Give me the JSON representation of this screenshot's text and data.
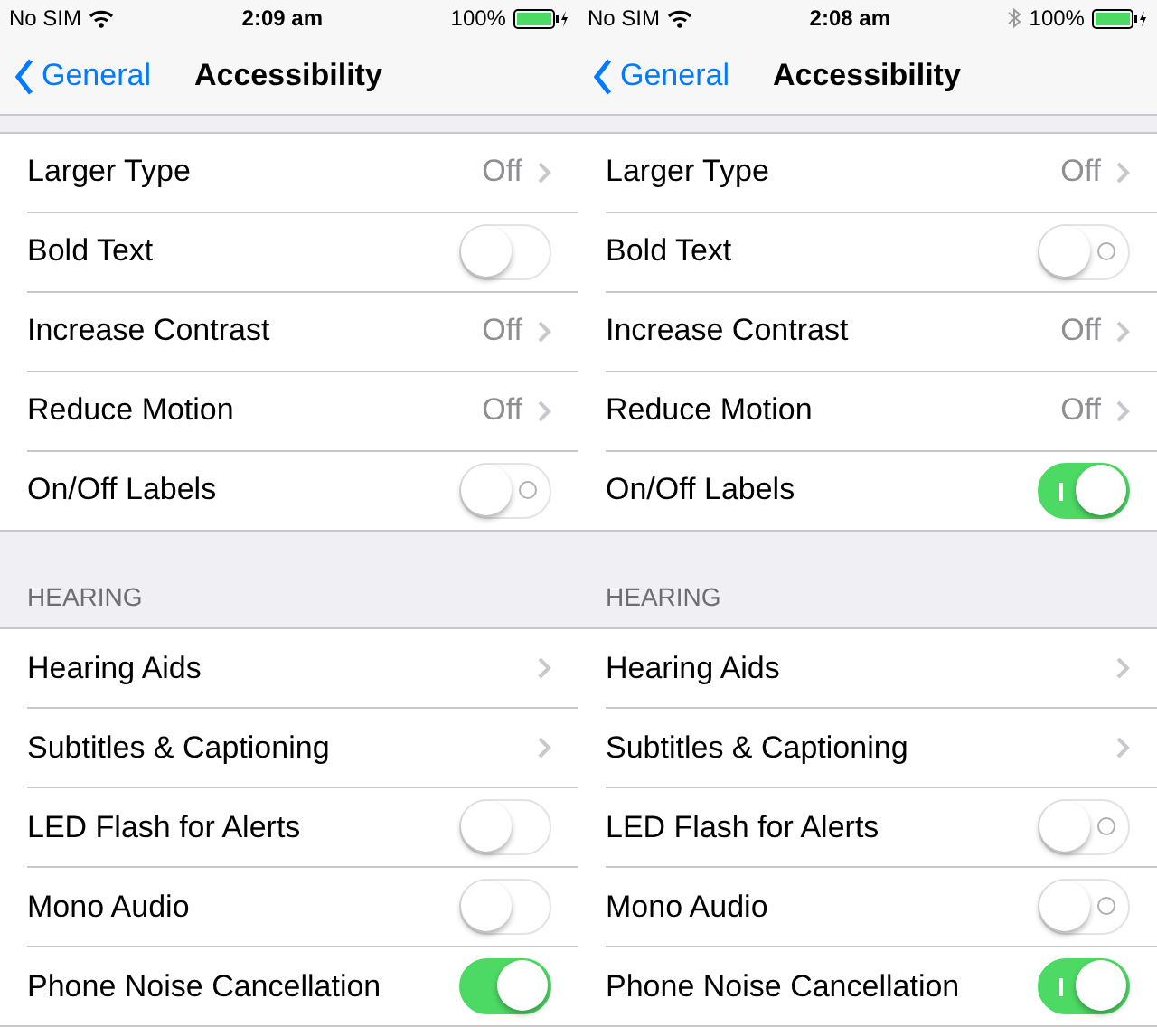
{
  "screens": [
    {
      "status_bar": {
        "carrier": "No SIM",
        "time": "2:09 am",
        "bluetooth": false,
        "battery": "100%"
      },
      "nav": {
        "back": "General",
        "title": "Accessibility"
      },
      "sections": [
        {
          "rows": [
            {
              "kind": "disclosure",
              "label": "Larger Type",
              "value": "Off"
            },
            {
              "kind": "switch",
              "label": "Bold Text",
              "on": false,
              "label_mark": false
            },
            {
              "kind": "disclosure",
              "label": "Increase Contrast",
              "value": "Off"
            },
            {
              "kind": "disclosure",
              "label": "Reduce Motion",
              "value": "Off"
            },
            {
              "kind": "switch",
              "label": "On/Off Labels",
              "on": false,
              "label_mark": true
            }
          ]
        },
        {
          "header": "HEARING",
          "rows": [
            {
              "kind": "disclosure",
              "label": "Hearing Aids"
            },
            {
              "kind": "disclosure",
              "label": "Subtitles & Captioning"
            },
            {
              "kind": "switch",
              "label": "LED Flash for Alerts",
              "on": false,
              "label_mark": false
            },
            {
              "kind": "switch",
              "label": "Mono Audio",
              "on": false,
              "label_mark": false
            },
            {
              "kind": "switch",
              "label": "Phone Noise Cancellation",
              "on": true,
              "label_mark": false
            }
          ]
        }
      ]
    },
    {
      "status_bar": {
        "carrier": "No SIM",
        "time": "2:08 am",
        "bluetooth": true,
        "battery": "100%"
      },
      "nav": {
        "back": "General",
        "title": "Accessibility"
      },
      "sections": [
        {
          "rows": [
            {
              "kind": "disclosure",
              "label": "Larger Type",
              "value": "Off"
            },
            {
              "kind": "switch",
              "label": "Bold Text",
              "on": false,
              "label_mark": true
            },
            {
              "kind": "disclosure",
              "label": "Increase Contrast",
              "value": "Off"
            },
            {
              "kind": "disclosure",
              "label": "Reduce Motion",
              "value": "Off"
            },
            {
              "kind": "switch",
              "label": "On/Off Labels",
              "on": true,
              "label_mark": true
            }
          ]
        },
        {
          "header": "HEARING",
          "rows": [
            {
              "kind": "disclosure",
              "label": "Hearing Aids"
            },
            {
              "kind": "disclosure",
              "label": "Subtitles & Captioning"
            },
            {
              "kind": "switch",
              "label": "LED Flash for Alerts",
              "on": false,
              "label_mark": true
            },
            {
              "kind": "switch",
              "label": "Mono Audio",
              "on": false,
              "label_mark": true
            },
            {
              "kind": "switch",
              "label": "Phone Noise Cancellation",
              "on": true,
              "label_mark": true
            }
          ]
        }
      ]
    }
  ]
}
